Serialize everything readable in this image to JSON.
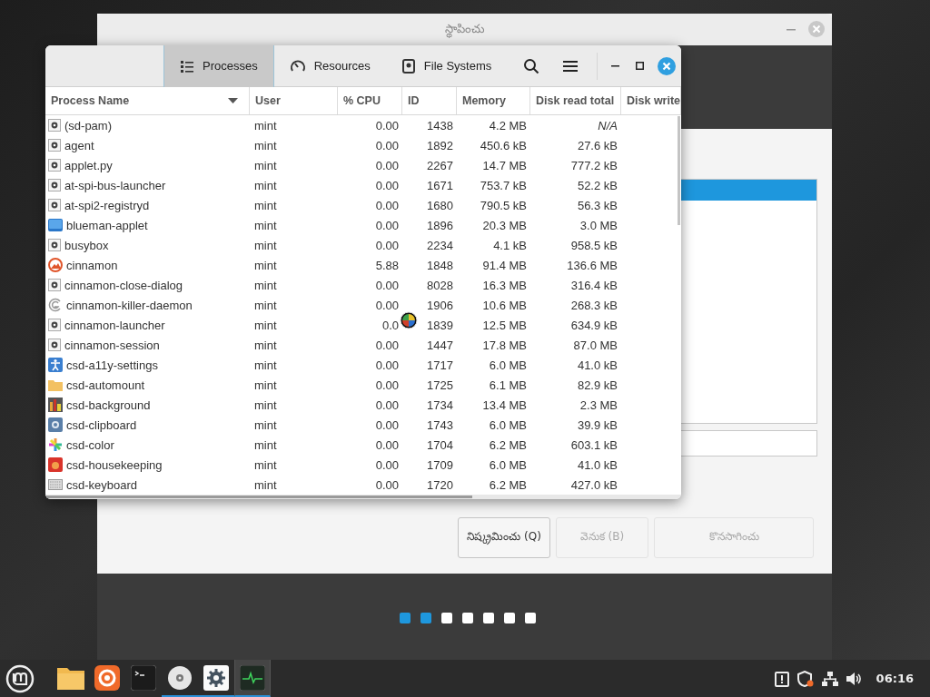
{
  "installer": {
    "title": "స్థాపించు",
    "buttons": [
      {
        "label": "నిష్క్రమించు (Q)",
        "disabled": false
      },
      {
        "label": "వెనుక (B)",
        "disabled": true
      },
      {
        "label": "కొనసాగించు",
        "disabled": true
      }
    ],
    "steps": [
      {
        "done": true
      },
      {
        "done": true
      },
      {
        "done": false
      },
      {
        "done": false
      },
      {
        "done": false
      },
      {
        "done": false
      },
      {
        "done": false
      }
    ]
  },
  "monitor": {
    "tabs": [
      {
        "label": "Processes",
        "kind": "list",
        "selected": true
      },
      {
        "label": "Resources",
        "kind": "gauge",
        "selected": false
      },
      {
        "label": "File Systems",
        "kind": "disk",
        "selected": false
      }
    ],
    "columns": [
      "Process Name",
      "User",
      "% CPU",
      "ID",
      "Memory",
      "Disk read total",
      "Disk write"
    ],
    "rows": [
      {
        "kind": "gear",
        "name": "(sd-pam)",
        "user": "mint",
        "cpu": "0.00",
        "id": "1438",
        "memory": "4.2 MB",
        "disk_read": "N/A"
      },
      {
        "kind": "gear",
        "name": "agent",
        "user": "mint",
        "cpu": "0.00",
        "id": "1892",
        "memory": "450.6 kB",
        "disk_read": "27.6 kB"
      },
      {
        "kind": "gear",
        "name": "applet.py",
        "user": "mint",
        "cpu": "0.00",
        "id": "2267",
        "memory": "14.7 MB",
        "disk_read": "777.2 kB"
      },
      {
        "kind": "gear",
        "name": "at-spi-bus-launcher",
        "user": "mint",
        "cpu": "0.00",
        "id": "1671",
        "memory": "753.7 kB",
        "disk_read": "52.2 kB"
      },
      {
        "kind": "gear",
        "name": "at-spi2-registryd",
        "user": "mint",
        "cpu": "0.00",
        "id": "1680",
        "memory": "790.5 kB",
        "disk_read": "56.3 kB"
      },
      {
        "kind": "bluesquare",
        "name": "blueman-applet",
        "user": "mint",
        "cpu": "0.00",
        "id": "1896",
        "memory": "20.3 MB",
        "disk_read": "3.0 MB"
      },
      {
        "kind": "gear",
        "name": "busybox",
        "user": "mint",
        "cpu": "0.00",
        "id": "2234",
        "memory": "4.1 kB",
        "disk_read": "958.5 kB"
      },
      {
        "kind": "cinnamon",
        "name": "cinnamon",
        "user": "mint",
        "cpu": "5.88",
        "id": "1848",
        "memory": "91.4 MB",
        "disk_read": "136.6 MB"
      },
      {
        "kind": "gear",
        "name": "cinnamon-close-dialog",
        "user": "mint",
        "cpu": "0.00",
        "id": "8028",
        "memory": "16.3 MB",
        "disk_read": "316.4 kB"
      },
      {
        "kind": "ring",
        "name": "cinnamon-killer-daemon",
        "user": "mint",
        "cpu": "0.00",
        "id": "1906",
        "memory": "10.6 MB",
        "disk_read": "268.3 kB"
      },
      {
        "kind": "gear",
        "name": "cinnamon-launcher",
        "user": "mint",
        "cpu": "0.0",
        "id": "1839",
        "memory": "12.5 MB",
        "disk_read": "634.9 kB"
      },
      {
        "kind": "gear",
        "name": "cinnamon-session",
        "user": "mint",
        "cpu": "0.00",
        "id": "1447",
        "memory": "17.8 MB",
        "disk_read": "87.0 MB"
      },
      {
        "kind": "person",
        "name": "csd-a11y-settings",
        "user": "mint",
        "cpu": "0.00",
        "id": "1717",
        "memory": "6.0 MB",
        "disk_read": "41.0 kB"
      },
      {
        "kind": "folder",
        "name": "csd-automount",
        "user": "mint",
        "cpu": "0.00",
        "id": "1725",
        "memory": "6.1 MB",
        "disk_read": "82.9 kB"
      },
      {
        "kind": "bars",
        "name": "csd-background",
        "user": "mint",
        "cpu": "0.00",
        "id": "1734",
        "memory": "13.4 MB",
        "disk_read": "2.3 MB"
      },
      {
        "kind": "clip",
        "name": "csd-clipboard",
        "user": "mint",
        "cpu": "0.00",
        "id": "1743",
        "memory": "6.0 MB",
        "disk_read": "39.9 kB"
      },
      {
        "kind": "flower",
        "name": "csd-color",
        "user": "mint",
        "cpu": "0.00",
        "id": "1704",
        "memory": "6.2 MB",
        "disk_read": "603.1 kB"
      },
      {
        "kind": "redbox",
        "name": "csd-housekeeping",
        "user": "mint",
        "cpu": "0.00",
        "id": "1709",
        "memory": "6.0 MB",
        "disk_read": "41.0 kB"
      },
      {
        "kind": "keyboard",
        "name": "csd-keyboard",
        "user": "mint",
        "cpu": "0.00",
        "id": "1720",
        "memory": "6.2 MB",
        "disk_read": "427.0 kB"
      }
    ]
  },
  "taskbar": {
    "apps": [
      {
        "kind": "files",
        "running": false,
        "selected": false
      },
      {
        "kind": "browser",
        "running": false,
        "selected": false
      },
      {
        "kind": "terminal",
        "running": false,
        "selected": false
      },
      {
        "kind": "disc",
        "running": true,
        "selected": false
      },
      {
        "kind": "settings",
        "running": true,
        "selected": false
      },
      {
        "kind": "monitor",
        "running": true,
        "selected": true
      }
    ],
    "clock": "06:16"
  }
}
